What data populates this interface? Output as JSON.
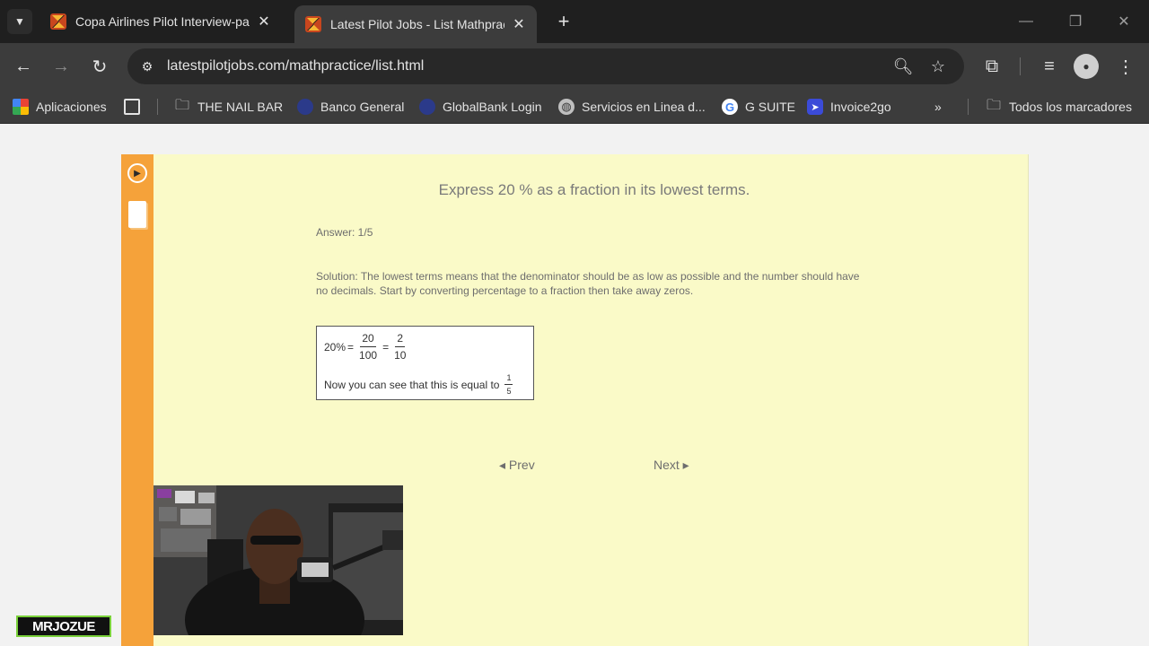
{
  "tabs": [
    {
      "title": "Copa Airlines Pilot Interview-pa",
      "active": false
    },
    {
      "title": "Latest Pilot Jobs - List Mathprac",
      "active": true
    }
  ],
  "toolbar": {
    "url": "latestpilotjobs.com/mathpractice/list.html"
  },
  "bookmarks": [
    {
      "label": "Aplicaciones",
      "icon": "apps-grid-icon"
    },
    {
      "label": "THE NAIL BAR",
      "icon": "folder-icon"
    },
    {
      "label": "Banco General",
      "icon": "globe-icon"
    },
    {
      "label": "GlobalBank Login",
      "icon": "globe-icon"
    },
    {
      "label": "Servicios en Linea d...",
      "icon": "globe-icon"
    },
    {
      "label": "G SUITE",
      "icon": "google-icon"
    },
    {
      "label": "Invoice2go",
      "icon": "invoice-icon"
    }
  ],
  "all_bookmarks_label": "Todos los marcadores",
  "content": {
    "question": "Express 20 % as a fraction in its lowest terms.",
    "answer": "Answer: 1/5",
    "solution": "Solution: The lowest terms means that the denominator should be as low as possible and the number should have no decimals.  Start by converting percentage to a fraction then take away zeros.",
    "math": {
      "lhs": "20%",
      "eq": "=",
      "frac1_num": "20",
      "frac1_den": "100",
      "frac2_num": "2",
      "frac2_den": "10",
      "note": "Now you can see that this is equal to",
      "result_num": "1",
      "result_den": "5"
    },
    "prev_label": "◂ Prev",
    "next_label": "Next ▸"
  },
  "watermark": "MRJOZUE",
  "colors": {
    "sidebar": "#f5a23a",
    "panel": "#fafac8",
    "chrome_dark": "#1f1f1f",
    "chrome_toolbar": "#3c3c3c"
  }
}
